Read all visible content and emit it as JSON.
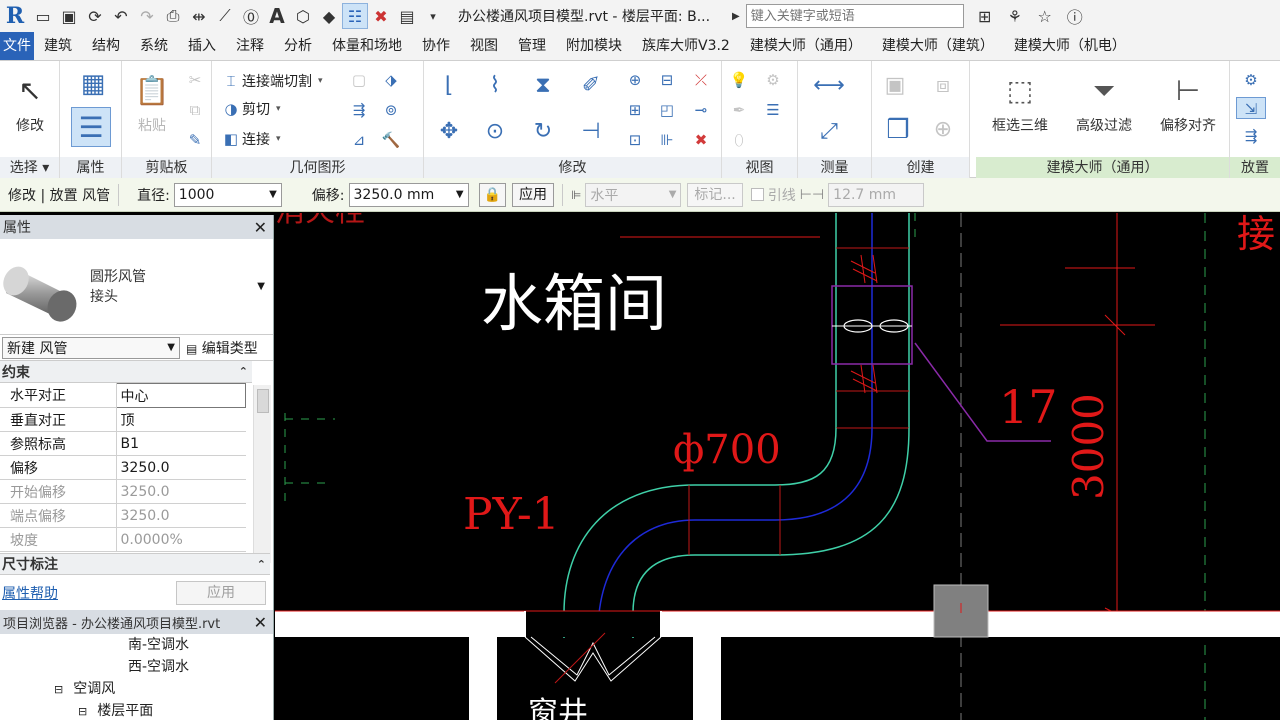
{
  "app": {
    "doc_title": "办公楼通风项目模型.rvt - 楼层平面: B...",
    "search_placeholder": "键入关键字或短语"
  },
  "quick_access": [
    "open-icon",
    "save-icon",
    "sync-icon",
    "undo-icon",
    "redo-icon",
    "print-icon",
    "measure-icon",
    "dimension-icon",
    "tag-icon",
    "text-icon",
    "3d-view-icon",
    "section-icon",
    "thin-lines-icon",
    "close-hidden-icon",
    "switch-windows-icon",
    "customize-icon"
  ],
  "tabs": [
    "文件",
    "建筑",
    "结构",
    "系统",
    "插入",
    "注释",
    "分析",
    "体量和场地",
    "协作",
    "视图",
    "管理",
    "附加模块",
    "族库大师V3.2",
    "建模大师（通用）",
    "建模大师（建筑）",
    "建模大师（机电）"
  ],
  "ribbon": {
    "select": {
      "button": "修改",
      "label": "选择"
    },
    "properties": {
      "label": "属性"
    },
    "clipboard": {
      "paste": "粘贴",
      "label": "剪贴板"
    },
    "geometry": {
      "cope": "连接端切割",
      "cut": "剪切",
      "join": "连接",
      "label": "几何图形"
    },
    "modify": {
      "label": "修改"
    },
    "view": {
      "label": "视图"
    },
    "measure": {
      "label": "测量"
    },
    "create": {
      "label": "创建"
    },
    "master": {
      "select3d": "框选三维",
      "filter": "高级过滤",
      "offset_align": "偏移对齐",
      "label": "建模大师（通用）"
    },
    "place": {
      "label": "放置"
    }
  },
  "options_bar": {
    "mode": "修改 | 放置 风管",
    "diameter_label": "直径:",
    "diameter_value": "1000",
    "offset_label": "偏移:",
    "offset_value": "3250.0 mm",
    "apply": "应用",
    "orientation": "水平",
    "tag": "标记...",
    "leader": "引线",
    "leader_length": "12.7 mm"
  },
  "properties": {
    "title": "属性",
    "type_name": "圆形风管",
    "type_sub": "接头",
    "instance_select": "新建 风管",
    "edit_type": "编辑类型",
    "group_constraints": "约束",
    "rows": [
      {
        "k": "水平对正",
        "v": "中心",
        "disabled": false
      },
      {
        "k": "垂直对正",
        "v": "顶",
        "disabled": false
      },
      {
        "k": "参照标高",
        "v": "B1",
        "disabled": false
      },
      {
        "k": "偏移",
        "v": "3250.0",
        "disabled": false
      },
      {
        "k": "开始偏移",
        "v": "3250.0",
        "disabled": true
      },
      {
        "k": "端点偏移",
        "v": "3250.0",
        "disabled": true
      },
      {
        "k": "坡度",
        "v": "0.0000%",
        "disabled": true
      }
    ],
    "group_dims": "尺寸标注",
    "help": "属性帮助",
    "apply": "应用"
  },
  "browser": {
    "title": "项目浏览器 - 办公楼通风项目模型.rvt",
    "nodes": [
      "南-空调水",
      "西-空调水",
      "空调风",
      "楼层平面"
    ]
  },
  "canvas": {
    "room_label": "水箱间",
    "duct_size": "ф700",
    "duct_tag": "PY-1",
    "tag_number": "17",
    "dimension": "3000",
    "shaft_label": "窗井",
    "top_right_text": "接",
    "top_left_text": "消火栓"
  },
  "colors": {
    "accent": "#2a63b8",
    "options_bg": "#f3f7ec",
    "duct_outline": "#3fd0a8",
    "duct_center": "#1e2ad8",
    "annotation_red": "#e01818"
  }
}
